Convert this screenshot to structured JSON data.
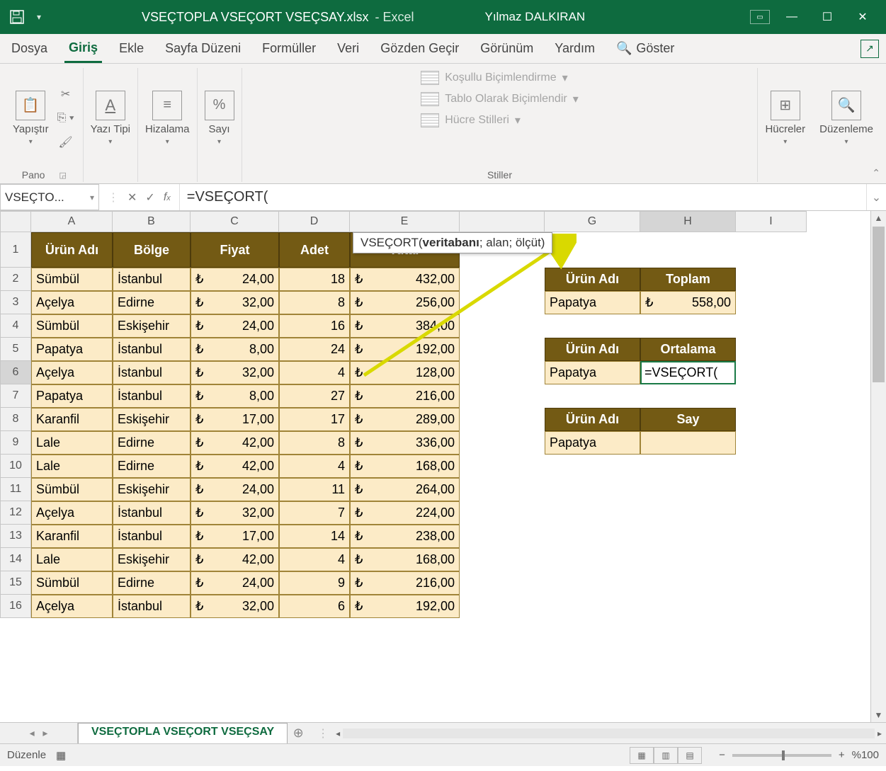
{
  "titlebar": {
    "filename": "VSEÇTOPLA VSEÇORT VSEÇSAY.xlsx",
    "app": "Excel",
    "user": "Yılmaz DALKIRAN"
  },
  "tabs": {
    "file": "Dosya",
    "home": "Giriş",
    "insert": "Ekle",
    "pagelayout": "Sayfa Düzeni",
    "formulas": "Formüller",
    "data": "Veri",
    "review": "Gözden Geçir",
    "view": "Görünüm",
    "help": "Yardım",
    "search": "Göster"
  },
  "ribbon": {
    "clipboard": {
      "paste": "Yapıştır",
      "label": "Pano"
    },
    "font": {
      "btn": "Yazı Tipi"
    },
    "align": {
      "btn": "Hizalama"
    },
    "number": {
      "btn": "Sayı"
    },
    "styles": {
      "cond": "Koşullu Biçimlendirme",
      "table": "Tablo Olarak Biçimlendir",
      "cell": "Hücre Stilleri",
      "label": "Stiller"
    },
    "cells": {
      "btn": "Hücreler"
    },
    "editing": {
      "btn": "Düzenleme"
    }
  },
  "fbar": {
    "namebox": "VSEÇTO...",
    "formula": "=VSEÇORT(",
    "tooltip_func": "VSEÇORT(",
    "tooltip_arg1": "veritabanı",
    "tooltip_rest": "; alan; ölçüt)"
  },
  "cols": [
    "A",
    "B",
    "C",
    "D",
    "E",
    "G",
    "H",
    "I"
  ],
  "colw": {
    "A": 115,
    "B": 110,
    "C": 125,
    "D": 100,
    "E": 155,
    "F": 120,
    "G": 135,
    "H": 135,
    "I": 100
  },
  "rows": [
    "1",
    "2",
    "3",
    "4",
    "5",
    "6",
    "7",
    "8",
    "9",
    "10",
    "11",
    "12",
    "13",
    "14",
    "15",
    "16"
  ],
  "headers": {
    "A": "Ürün Adı",
    "B": "Bölge",
    "C": "Fiyat",
    "D": "Adet",
    "E": "Tutar"
  },
  "data": [
    {
      "A": "Sümbül",
      "B": "İstanbul",
      "Cc": "₺",
      "Cv": "24,00",
      "D": "18",
      "Ec": "₺",
      "Ev": "432,00"
    },
    {
      "A": "Açelya",
      "B": "Edirne",
      "Cc": "₺",
      "Cv": "32,00",
      "D": "8",
      "Ec": "₺",
      "Ev": "256,00"
    },
    {
      "A": "Sümbül",
      "B": "Eskişehir",
      "Cc": "₺",
      "Cv": "24,00",
      "D": "16",
      "Ec": "₺",
      "Ev": "384,00"
    },
    {
      "A": "Papatya",
      "B": "İstanbul",
      "Cc": "₺",
      "Cv": "8,00",
      "D": "24",
      "Ec": "₺",
      "Ev": "192,00"
    },
    {
      "A": "Açelya",
      "B": "İstanbul",
      "Cc": "₺",
      "Cv": "32,00",
      "D": "4",
      "Ec": "₺",
      "Ev": "128,00"
    },
    {
      "A": "Papatya",
      "B": "İstanbul",
      "Cc": "₺",
      "Cv": "8,00",
      "D": "27",
      "Ec": "₺",
      "Ev": "216,00"
    },
    {
      "A": "Karanfil",
      "B": "Eskişehir",
      "Cc": "₺",
      "Cv": "17,00",
      "D": "17",
      "Ec": "₺",
      "Ev": "289,00"
    },
    {
      "A": "Lale",
      "B": "Edirne",
      "Cc": "₺",
      "Cv": "42,00",
      "D": "8",
      "Ec": "₺",
      "Ev": "336,00"
    },
    {
      "A": "Lale",
      "B": "Edirne",
      "Cc": "₺",
      "Cv": "42,00",
      "D": "4",
      "Ec": "₺",
      "Ev": "168,00"
    },
    {
      "A": "Sümbül",
      "B": "Eskişehir",
      "Cc": "₺",
      "Cv": "24,00",
      "D": "11",
      "Ec": "₺",
      "Ev": "264,00"
    },
    {
      "A": "Açelya",
      "B": "İstanbul",
      "Cc": "₺",
      "Cv": "32,00",
      "D": "7",
      "Ec": "₺",
      "Ev": "224,00"
    },
    {
      "A": "Karanfil",
      "B": "İstanbul",
      "Cc": "₺",
      "Cv": "17,00",
      "D": "14",
      "Ec": "₺",
      "Ev": "238,00"
    },
    {
      "A": "Lale",
      "B": "Eskişehir",
      "Cc": "₺",
      "Cv": "42,00",
      "D": "4",
      "Ec": "₺",
      "Ev": "168,00"
    },
    {
      "A": "Sümbül",
      "B": "Edirne",
      "Cc": "₺",
      "Cv": "24,00",
      "D": "9",
      "Ec": "₺",
      "Ev": "216,00"
    },
    {
      "A": "Açelya",
      "B": "İstanbul",
      "Cc": "₺",
      "Cv": "32,00",
      "D": "6",
      "Ec": "₺",
      "Ev": "192,00"
    }
  ],
  "side": {
    "t1": {
      "G": "Ürün Adı",
      "H": "Toplam",
      "Gv": "Papatya",
      "Hc": "₺",
      "Hv": "558,00"
    },
    "t2": {
      "G": "Ürün Adı",
      "H": "Ortalama",
      "Gv": "Papatya",
      "Hv": "=VSEÇORT("
    },
    "t3": {
      "G": "Ürün Adı",
      "H": "Say",
      "Gv": "Papatya"
    }
  },
  "sheet": {
    "name": "VSEÇTOPLA VSEÇORT VSEÇSAY"
  },
  "status": {
    "mode": "Düzenle",
    "zoom": "%100"
  }
}
